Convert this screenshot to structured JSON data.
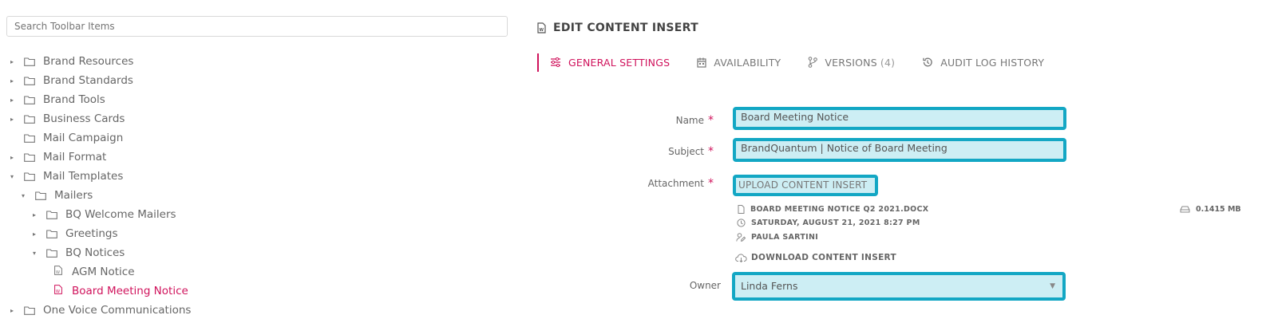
{
  "search": {
    "placeholder": "Search Toolbar Items"
  },
  "tree": [
    {
      "label": "Brand Resources",
      "level": 0,
      "caret": "▸",
      "icon": "folder"
    },
    {
      "label": "Brand Standards",
      "level": 0,
      "caret": "▸",
      "icon": "folder"
    },
    {
      "label": "Brand Tools",
      "level": 0,
      "caret": "▸",
      "icon": "folder"
    },
    {
      "label": "Business Cards",
      "level": 0,
      "caret": "▸",
      "icon": "folder"
    },
    {
      "label": "Mail Campaign",
      "level": 0,
      "caret": "",
      "icon": "folder"
    },
    {
      "label": "Mail Format",
      "level": 0,
      "caret": "▸",
      "icon": "folder"
    },
    {
      "label": "Mail Templates",
      "level": 0,
      "caret": "▾",
      "icon": "folder"
    },
    {
      "label": "Mailers",
      "level": 1,
      "caret": "▾",
      "icon": "folder"
    },
    {
      "label": "BQ Welcome Mailers",
      "level": 2,
      "caret": "▸",
      "icon": "folder"
    },
    {
      "label": "Greetings",
      "level": 2,
      "caret": "▸",
      "icon": "folder"
    },
    {
      "label": "BQ Notices",
      "level": 2,
      "caret": "▾",
      "icon": "folder"
    },
    {
      "label": "AGM Notice",
      "level": 3,
      "caret": "",
      "icon": "word-doc"
    },
    {
      "label": "Board Meeting Notice",
      "level": 3,
      "caret": "",
      "icon": "word-doc",
      "active": true
    },
    {
      "label": "One Voice Communications",
      "level": 0,
      "caret": "▸",
      "icon": "folder"
    }
  ],
  "header": {
    "title": "EDIT CONTENT INSERT"
  },
  "tabs": {
    "general": "GENERAL SETTINGS",
    "availability": "AVAILABILITY",
    "versions": "VERSIONS",
    "versions_count": "(4)",
    "audit": "AUDIT LOG HISTORY"
  },
  "form": {
    "name_label": "Name",
    "name_value": "Board Meeting Notice",
    "subject_label": "Subject",
    "subject_value": "BrandQuantum | Notice of Board Meeting",
    "attachment_label": "Attachment",
    "upload_label": "UPLOAD CONTENT INSERT",
    "required_mark": "*",
    "file_name": "BOARD MEETING NOTICE Q2 2021.DOCX",
    "file_date": "SATURDAY, AUGUST 21, 2021 8:27 PM",
    "file_user": "PAULA SARTINI",
    "file_size": "0.1415 MB",
    "download_label": "DOWNLOAD CONTENT INSERT",
    "owner_label": "Owner",
    "owner_value": "Linda Ferns"
  },
  "colors": {
    "accent": "#d0135c",
    "highlight_border": "#13a7c4",
    "highlight_fill": "#cdeef4"
  }
}
